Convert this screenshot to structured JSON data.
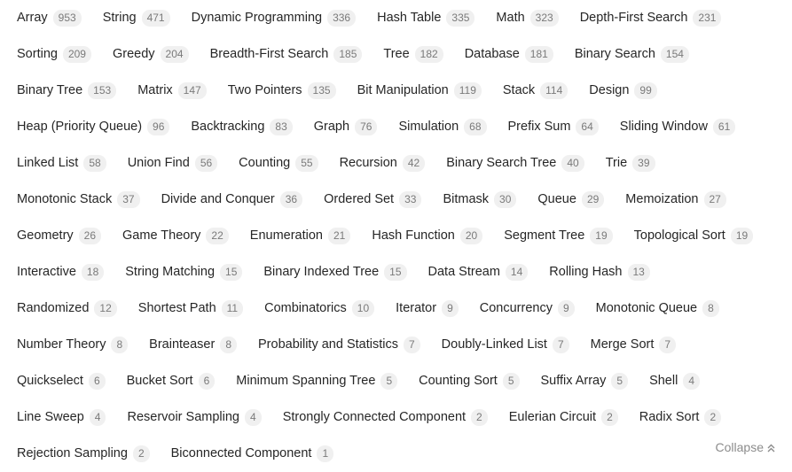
{
  "tags": [
    {
      "label": "Array",
      "count": "953"
    },
    {
      "label": "String",
      "count": "471"
    },
    {
      "label": "Dynamic Programming",
      "count": "336"
    },
    {
      "label": "Hash Table",
      "count": "335"
    },
    {
      "label": "Math",
      "count": "323"
    },
    {
      "label": "Depth-First Search",
      "count": "231"
    },
    {
      "label": "Sorting",
      "count": "209"
    },
    {
      "label": "Greedy",
      "count": "204"
    },
    {
      "label": "Breadth-First Search",
      "count": "185"
    },
    {
      "label": "Tree",
      "count": "182"
    },
    {
      "label": "Database",
      "count": "181"
    },
    {
      "label": "Binary Search",
      "count": "154"
    },
    {
      "label": "Binary Tree",
      "count": "153"
    },
    {
      "label": "Matrix",
      "count": "147"
    },
    {
      "label": "Two Pointers",
      "count": "135"
    },
    {
      "label": "Bit Manipulation",
      "count": "119"
    },
    {
      "label": "Stack",
      "count": "114"
    },
    {
      "label": "Design",
      "count": "99"
    },
    {
      "label": "Heap (Priority Queue)",
      "count": "96"
    },
    {
      "label": "Backtracking",
      "count": "83"
    },
    {
      "label": "Graph",
      "count": "76"
    },
    {
      "label": "Simulation",
      "count": "68"
    },
    {
      "label": "Prefix Sum",
      "count": "64"
    },
    {
      "label": "Sliding Window",
      "count": "61"
    },
    {
      "label": "Linked List",
      "count": "58"
    },
    {
      "label": "Union Find",
      "count": "56"
    },
    {
      "label": "Counting",
      "count": "55"
    },
    {
      "label": "Recursion",
      "count": "42"
    },
    {
      "label": "Binary Search Tree",
      "count": "40"
    },
    {
      "label": "Trie",
      "count": "39"
    },
    {
      "label": "Monotonic Stack",
      "count": "37"
    },
    {
      "label": "Divide and Conquer",
      "count": "36"
    },
    {
      "label": "Ordered Set",
      "count": "33"
    },
    {
      "label": "Bitmask",
      "count": "30"
    },
    {
      "label": "Queue",
      "count": "29"
    },
    {
      "label": "Memoization",
      "count": "27"
    },
    {
      "label": "Geometry",
      "count": "26"
    },
    {
      "label": "Game Theory",
      "count": "22"
    },
    {
      "label": "Enumeration",
      "count": "21"
    },
    {
      "label": "Hash Function",
      "count": "20"
    },
    {
      "label": "Segment Tree",
      "count": "19"
    },
    {
      "label": "Topological Sort",
      "count": "19"
    },
    {
      "label": "Interactive",
      "count": "18"
    },
    {
      "label": "String Matching",
      "count": "15"
    },
    {
      "label": "Binary Indexed Tree",
      "count": "15"
    },
    {
      "label": "Data Stream",
      "count": "14"
    },
    {
      "label": "Rolling Hash",
      "count": "13"
    },
    {
      "label": "Randomized",
      "count": "12"
    },
    {
      "label": "Shortest Path",
      "count": "11"
    },
    {
      "label": "Combinatorics",
      "count": "10"
    },
    {
      "label": "Iterator",
      "count": "9"
    },
    {
      "label": "Concurrency",
      "count": "9"
    },
    {
      "label": "Monotonic Queue",
      "count": "8"
    },
    {
      "label": "Number Theory",
      "count": "8"
    },
    {
      "label": "Brainteaser",
      "count": "8"
    },
    {
      "label": "Probability and Statistics",
      "count": "7"
    },
    {
      "label": "Doubly-Linked List",
      "count": "7"
    },
    {
      "label": "Merge Sort",
      "count": "7"
    },
    {
      "label": "Quickselect",
      "count": "6"
    },
    {
      "label": "Bucket Sort",
      "count": "6"
    },
    {
      "label": "Minimum Spanning Tree",
      "count": "5"
    },
    {
      "label": "Counting Sort",
      "count": "5"
    },
    {
      "label": "Suffix Array",
      "count": "5"
    },
    {
      "label": "Shell",
      "count": "4"
    },
    {
      "label": "Line Sweep",
      "count": "4"
    },
    {
      "label": "Reservoir Sampling",
      "count": "4"
    },
    {
      "label": "Strongly Connected Component",
      "count": "2"
    },
    {
      "label": "Eulerian Circuit",
      "count": "2"
    },
    {
      "label": "Radix Sort",
      "count": "2"
    },
    {
      "label": "Rejection Sampling",
      "count": "2"
    },
    {
      "label": "Biconnected Component",
      "count": "1"
    }
  ],
  "collapse": {
    "label": "Collapse",
    "icon": "double-chevron-up-icon"
  },
  "colors": {
    "text": "#262626",
    "count_bg": "#f0f0f0",
    "count_text": "#7a7a7a",
    "muted": "#8c8c8c"
  }
}
